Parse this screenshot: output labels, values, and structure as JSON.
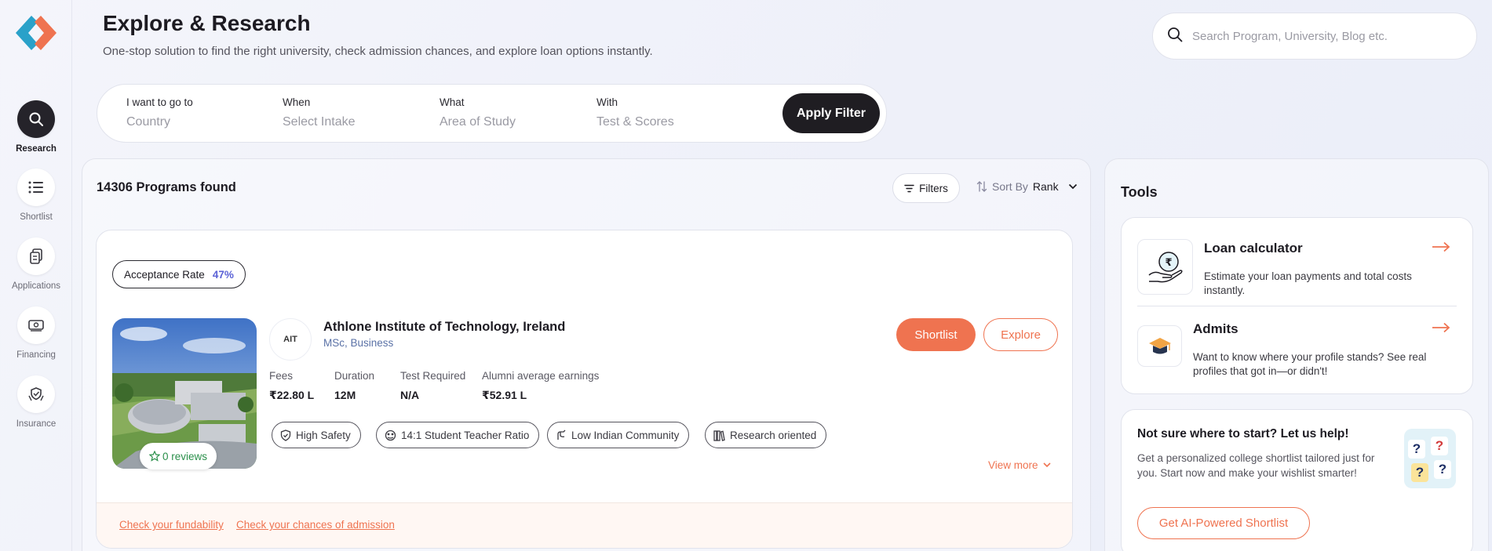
{
  "header": {
    "title": "Explore & Research",
    "subtitle": "One-stop solution to find the right university, check admission chances, and explore loan options instantly."
  },
  "search": {
    "placeholder": "Search Program, University, Blog etc."
  },
  "sidebar": {
    "items": [
      {
        "label": "Research",
        "icon": "search-icon",
        "active": true
      },
      {
        "label": "Shortlist",
        "icon": "list-icon",
        "active": false
      },
      {
        "label": "Applications",
        "icon": "documents-icon",
        "active": false
      },
      {
        "label": "Financing",
        "icon": "money-icon",
        "active": false
      },
      {
        "label": "Insurance",
        "icon": "shield-hand-icon",
        "active": false
      }
    ]
  },
  "filter_bar": {
    "fields": [
      {
        "label": "I want to go to",
        "placeholder": "Country"
      },
      {
        "label": "When",
        "placeholder": "Select Intake"
      },
      {
        "label": "What",
        "placeholder": "Area of Study"
      },
      {
        "label": "With",
        "placeholder": "Test & Scores"
      }
    ],
    "apply_label": "Apply Filter"
  },
  "results": {
    "count_text": "14306 Programs found",
    "filters_label": "Filters",
    "sort_label": "Sort By",
    "sort_value": "Rank"
  },
  "program": {
    "acceptance_label": "Acceptance Rate",
    "acceptance_value": "47%",
    "reviews_text": "0 reviews",
    "logo_text": "AIT",
    "university": "Athlone Institute of Technology, Ireland",
    "course": "MSc, Business",
    "stats": [
      {
        "label": "Fees",
        "value": "₹22.80 L"
      },
      {
        "label": "Duration",
        "value": "12M"
      },
      {
        "label": "Test Required",
        "value": "N/A"
      },
      {
        "label": "Alumni average earnings",
        "value": "₹52.91 L"
      }
    ],
    "tags": [
      {
        "label": "High Safety",
        "icon": "shield-check-icon"
      },
      {
        "label": "14:1 Student Teacher Ratio",
        "icon": "ratio-icon"
      },
      {
        "label": "Low Indian Community",
        "icon": "community-icon"
      },
      {
        "label": "Research oriented",
        "icon": "books-icon"
      }
    ],
    "shortlist_label": "Shortlist",
    "explore_label": "Explore",
    "view_more_label": "View more",
    "footer_links": [
      "Check your fundability",
      "Check your chances of admission"
    ]
  },
  "tools": {
    "title": "Tools",
    "items": [
      {
        "title": "Loan calculator",
        "desc": "Estimate your loan payments and total costs instantly.",
        "icon": "loan-hand-icon"
      },
      {
        "title": "Admits",
        "desc": "Want to know where your profile stands? See real profiles that got in—or didn't!",
        "icon": "graduation-cap-icon"
      }
    ]
  },
  "help": {
    "title": "Not sure where to start? Let us help!",
    "desc": "Get a personalized college shortlist tailored just for you. Start now and make your wishlist smarter!",
    "button_label": "Get AI-Powered Shortlist"
  },
  "colors": {
    "accent": "#ef7350",
    "dark": "#1f1d22",
    "acceptance": "#5b62d6",
    "review_green": "#2a8f4a"
  }
}
